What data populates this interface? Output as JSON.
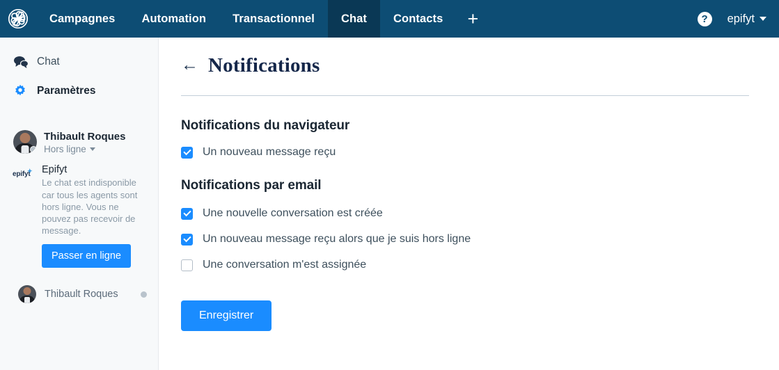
{
  "topnav": {
    "logo_name": "pinwheel-logo",
    "items": [
      {
        "label": "Campagnes",
        "active": false
      },
      {
        "label": "Automation",
        "active": false
      },
      {
        "label": "Transactionnel",
        "active": false
      },
      {
        "label": "Chat",
        "active": true
      },
      {
        "label": "Contacts",
        "active": false
      }
    ],
    "add_label": "+",
    "help_label": "?",
    "account_label": "epifyt",
    "bg_color": "#0d4d74",
    "active_bg_color": "#0a3855"
  },
  "sidebar": {
    "links": [
      {
        "label": "Chat",
        "icon": "chat-bubbles-icon",
        "active": false
      },
      {
        "label": "Paramètres",
        "icon": "gear-icon",
        "active": true
      }
    ],
    "profile": {
      "name": "Thibault Roques",
      "status": "Hors ligne"
    },
    "org": {
      "logo_text": "epifyt",
      "name": "Epifyt",
      "description": "Le chat est indisponible car tous les agents sont hors ligne. Vous ne pouvez pas recevoir de message.",
      "button_label": "Passer en ligne"
    },
    "agents": [
      {
        "name": "Thibault Roques",
        "online": false
      }
    ]
  },
  "main": {
    "title": "Notifications",
    "back_icon": "arrow-left-icon",
    "sections": [
      {
        "title": "Notifications du navigateur",
        "options": [
          {
            "label": "Un nouveau message reçu",
            "checked": true
          }
        ]
      },
      {
        "title": "Notifications par email",
        "options": [
          {
            "label": "Une nouvelle conversation est créée",
            "checked": true
          },
          {
            "label": "Un nouveau message reçu alors que je suis hors ligne",
            "checked": true
          },
          {
            "label": "Une conversation m'est assignée",
            "checked": false
          }
        ]
      }
    ],
    "save_label": "Enregistrer"
  },
  "colors": {
    "accent_blue": "#1a8cff",
    "nav_blue": "#0d4d74",
    "title_navy": "#15274a"
  }
}
